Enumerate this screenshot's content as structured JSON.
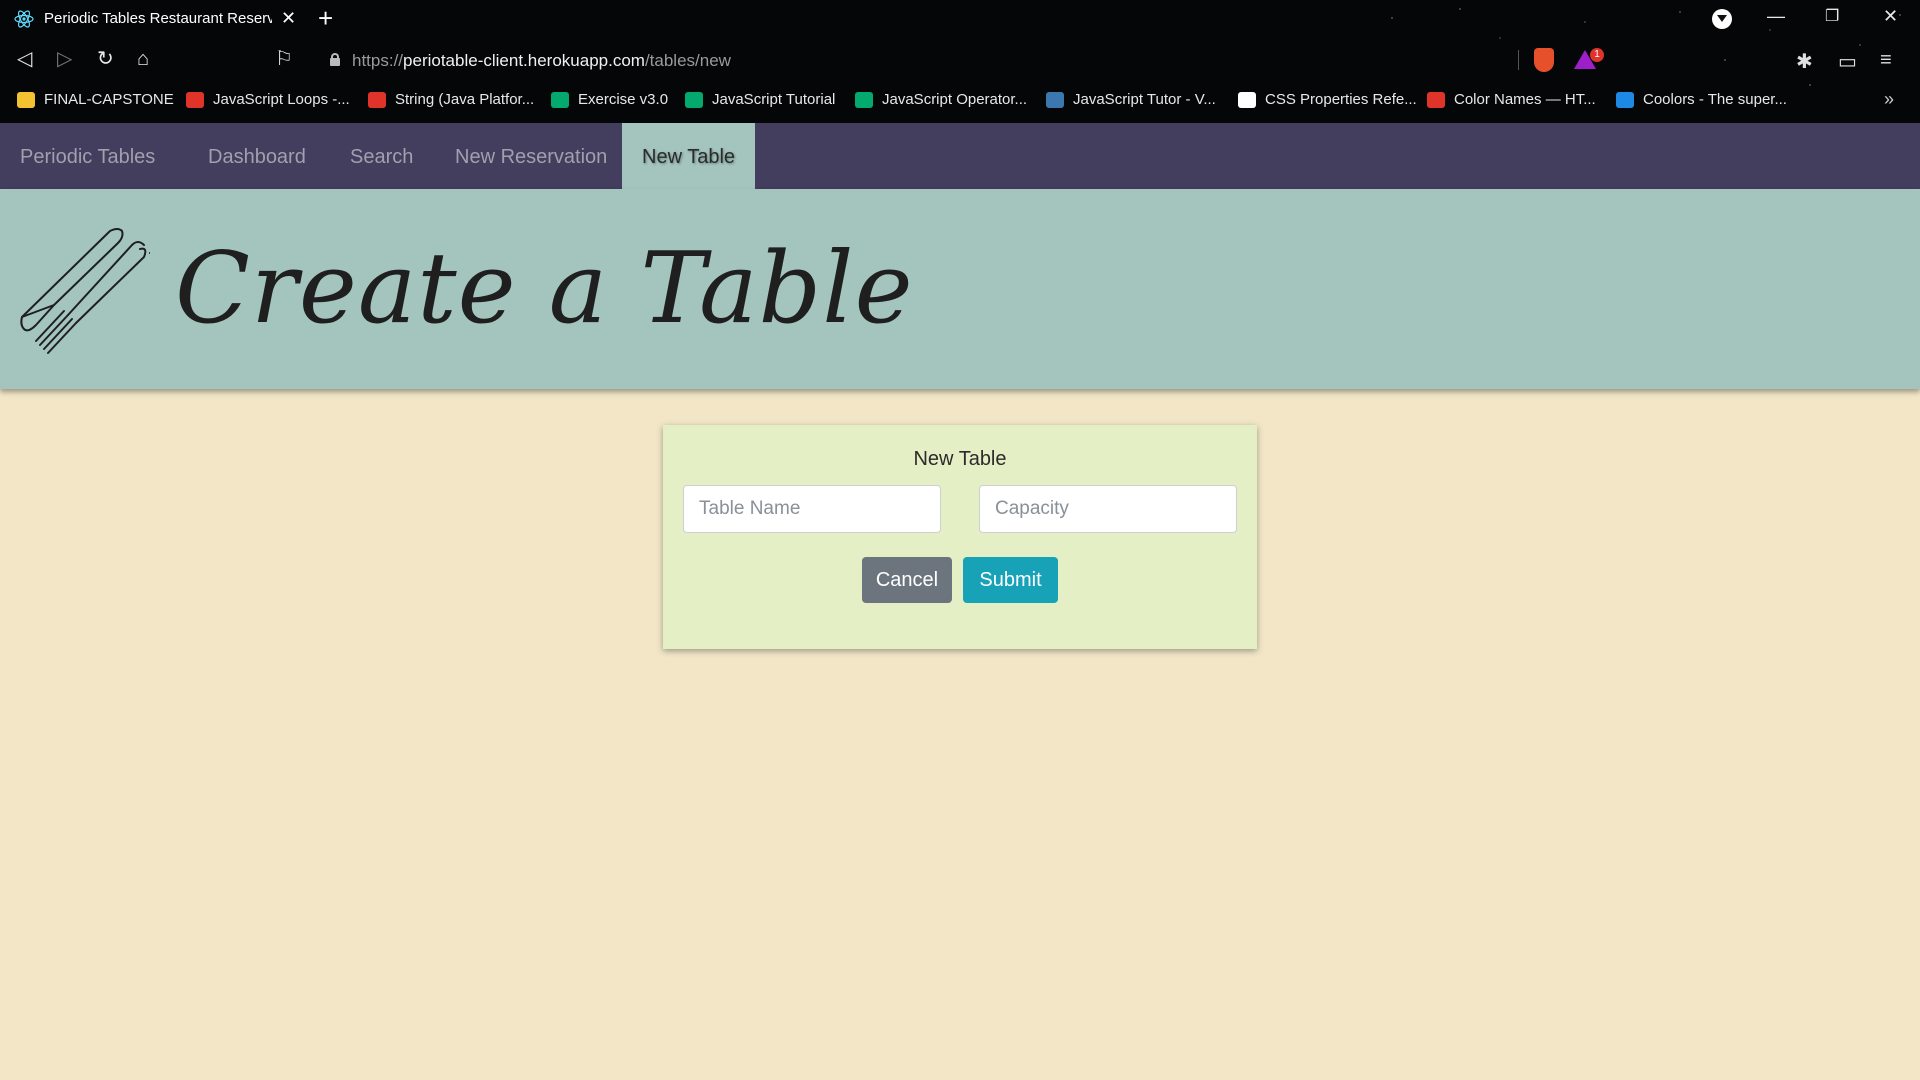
{
  "browser": {
    "tab_title": "Periodic Tables Restaurant Reserv",
    "url_scheme": "https://",
    "url_host": "periotable-client.herokuapp.com",
    "url_path": "/tables/new",
    "rewards_count": "1",
    "bookmarks": [
      {
        "label": "FINAL-CAPSTONE",
        "color": "#f2c230"
      },
      {
        "label": "JavaScript Loops -...",
        "color": "#e0342a"
      },
      {
        "label": "String (Java Platfor...",
        "color": "#e0342a"
      },
      {
        "label": "Exercise v3.0",
        "color": "#04aa6d"
      },
      {
        "label": "JavaScript Tutorial",
        "color": "#04aa6d"
      },
      {
        "label": "JavaScript Operator...",
        "color": "#04aa6d"
      },
      {
        "label": "JavaScript Tutor - V...",
        "color": "#3b78b0"
      },
      {
        "label": "CSS Properties Refe...",
        "color": "#ffffff"
      },
      {
        "label": "Color Names — HT...",
        "color": "#e0342a"
      },
      {
        "label": "Coolors - The super...",
        "color": "#1e88e5"
      }
    ]
  },
  "appnav": {
    "brand": "Periodic Tables",
    "links": [
      "Dashboard",
      "Search",
      "New Reservation",
      "New Table"
    ],
    "active": "New Table",
    "bg_color": "#433d5e",
    "active_color": "#a3c5bd"
  },
  "hero": {
    "title": "Create a Table"
  },
  "form": {
    "heading": "New Table",
    "table_name_placeholder": "Table Name",
    "capacity_placeholder": "Capacity",
    "cancel_label": "Cancel",
    "submit_label": "Submit"
  }
}
